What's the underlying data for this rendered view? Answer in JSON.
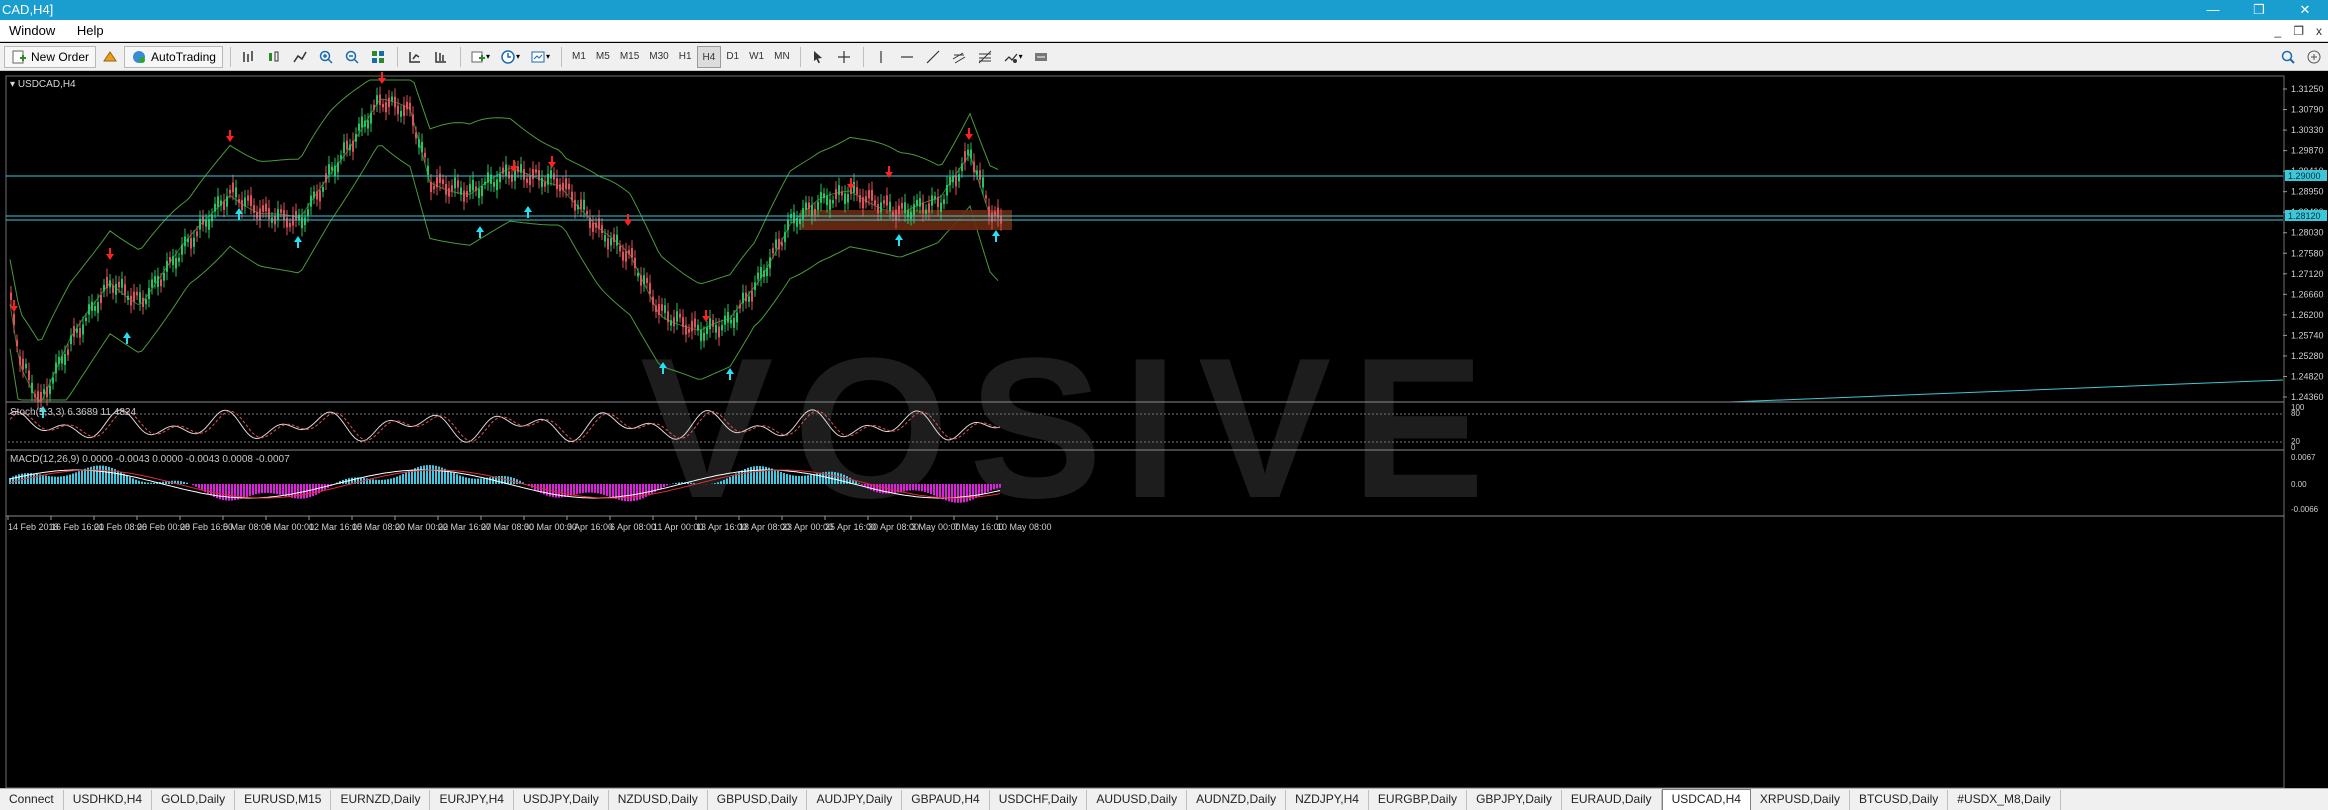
{
  "window": {
    "title": "CAD,H4]",
    "min_label": "—",
    "restore_label": "❐",
    "close_label": "✕"
  },
  "menu": {
    "items": [
      "Window",
      "Help"
    ],
    "mdi": [
      "_",
      "❐",
      "x"
    ]
  },
  "toolbar": {
    "new_order_label": "New Order",
    "autotrading_label": "AutoTrading",
    "timeframes": [
      "M1",
      "M5",
      "M15",
      "M30",
      "H1",
      "H4",
      "D1",
      "W1",
      "MN"
    ],
    "active_timeframe": "H4"
  },
  "chart": {
    "symbol_label": "USDCAD,H4",
    "watermark": "VOSIVE",
    "price_ticks": [
      "1.31250",
      "1.30790",
      "1.30330",
      "1.29870",
      "1.29410",
      "1.28950",
      "1.28490",
      "1.28030",
      "1.27580",
      "1.27120",
      "1.26660",
      "1.26200",
      "1.25740",
      "1.25280",
      "1.24820",
      "1.24360"
    ],
    "hline_labels": [
      "1.29000",
      "1.28120"
    ],
    "stoch_label": "Stoch(5,3,3) 6.3689 11.4824",
    "stoch_ticks": [
      "100",
      "80",
      "20",
      "0"
    ],
    "macd_label": "MACD(12,26,9) 0.0000 -0.0043 0.0000 -0.0043 0.0008 -0.0007",
    "macd_ticks": [
      "0.0067",
      "0.00",
      "-0.0066"
    ],
    "time_ticks": [
      "14 Feb 2018",
      "16 Feb 16:00",
      "21 Feb 08:00",
      "26 Feb 00:00",
      "28 Feb 16:00",
      "5 Mar 08:00",
      "8 Mar 00:00",
      "12 Mar 16:00",
      "15 Mar 08:00",
      "20 Mar 00:00",
      "22 Mar 16:00",
      "27 Mar 08:00",
      "30 Mar 00:00",
      "3 Apr 16:00",
      "6 Apr 08:00",
      "11 Apr 00:00",
      "13 Apr 16:00",
      "18 Apr 08:00",
      "23 Apr 00:00",
      "25 Apr 16:00",
      "30 Apr 08:00",
      "3 May 00:00",
      "7 May 16:00",
      "10 May 08:00"
    ]
  },
  "tabs": {
    "items": [
      "Connect",
      "USDHKD,H4",
      "GOLD,Daily",
      "EURUSD,M15",
      "EURNZD,Daily",
      "EURJPY,H4",
      "USDJPY,Daily",
      "NZDUSD,Daily",
      "GBPUSD,Daily",
      "AUDJPY,Daily",
      "GBPAUD,H4",
      "USDCHF,Daily",
      "AUDUSD,Daily",
      "AUDNZD,Daily",
      "NZDJPY,H4",
      "EURGBP,Daily",
      "GBPJPY,Daily",
      "EURAUD,Daily",
      "USDCAD,H4",
      "XRPUSD,Daily",
      "BTCUSD,Daily",
      "#USDX_M8,Daily"
    ],
    "active": "USDCAD,H4"
  },
  "colors": {
    "title_bg": "#1a9ed0",
    "bull": "#22c55e",
    "bear": "#e0515a",
    "band": "#4a9a3a",
    "hline": "#3cc8d8",
    "up_arrow": "#25e0f0",
    "down_arrow": "#ff2020",
    "zone": "#6a2a10",
    "macd_pos": "#40c8e0",
    "macd_neg": "#e020e0"
  }
}
